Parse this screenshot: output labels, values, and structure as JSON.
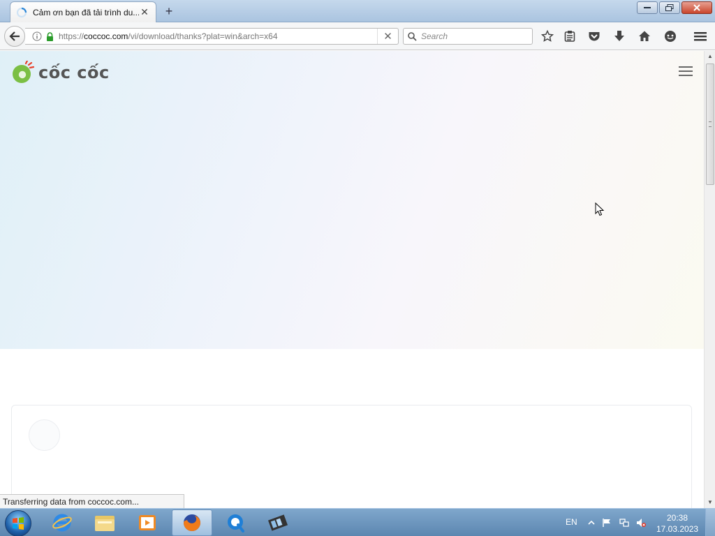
{
  "browser": {
    "tab": {
      "title": "Cảm ơn bạn đã tải trình du...",
      "close_icon": "close-icon"
    },
    "new_tab_label": "+",
    "url": {
      "scheme": "https://",
      "domain": "coccoc.com",
      "path": "/vi/download/thanks?plat=win&arch=x64"
    },
    "search_placeholder": "Search",
    "toolbar_icons": [
      "star-icon",
      "reading-list-icon",
      "pocket-icon",
      "download-icon",
      "home-icon",
      "chat-icon",
      "menu-icon"
    ]
  },
  "page": {
    "logo_text": "cốc cốc",
    "colors": {
      "brand_green": "#7bbf44",
      "brand_red": "#e8412c"
    }
  },
  "status": {
    "text": "Transferring data from coccoc.com..."
  },
  "taskbar": {
    "apps": [
      "internet-explorer-icon",
      "file-explorer-icon",
      "media-player-icon",
      "firefox-icon",
      "quicktime-icon",
      "movie-maker-icon"
    ],
    "language": "EN",
    "time": "20:38",
    "date": "17.03.2023"
  }
}
